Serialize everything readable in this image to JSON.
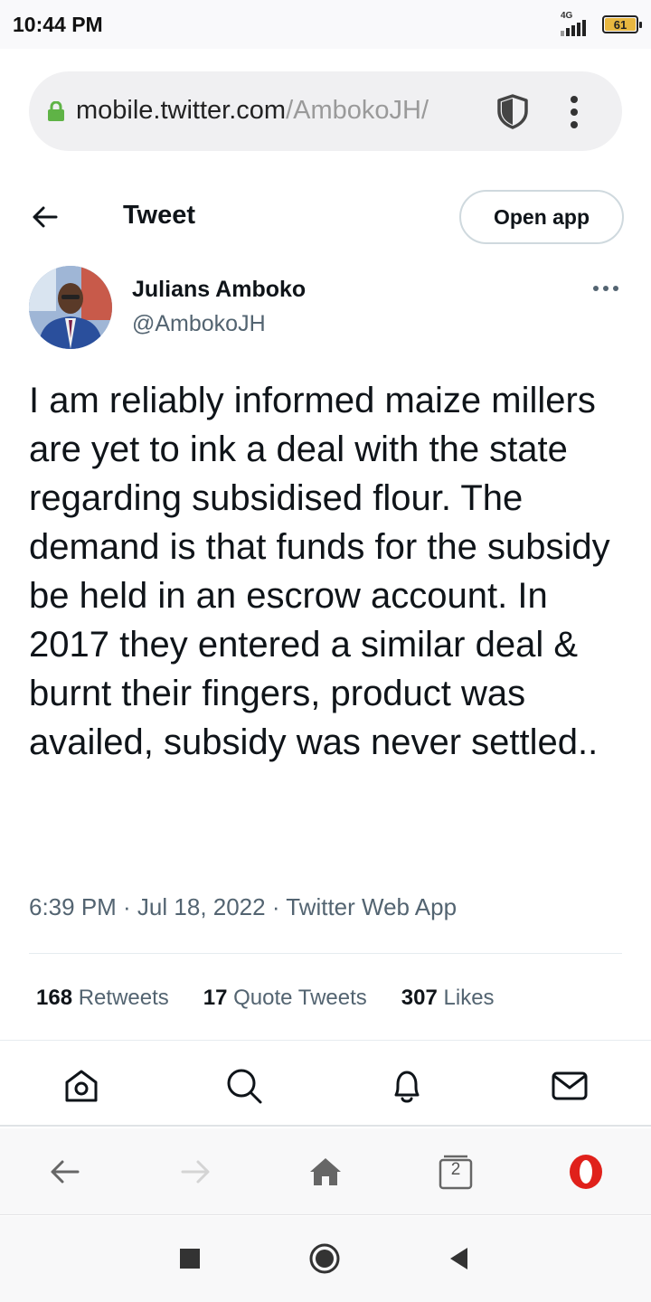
{
  "status_bar": {
    "time": "10:44 PM",
    "network": "4G",
    "battery": "61"
  },
  "browser": {
    "url_host": "mobile.twitter.com",
    "url_path": "/AmbokoJH/",
    "tab_count": "2"
  },
  "header": {
    "title": "Tweet",
    "open_app_label": "Open app"
  },
  "author": {
    "name": "Julians Amboko",
    "handle": "@AmbokoJH"
  },
  "tweet": {
    "text": "I am reliably informed maize millers are yet to ink a deal with the state regarding subsidised flour. The demand is that funds for the subsidy be held in an escrow account. In 2017 they entered a similar deal & burnt their fingers, product was availed, subsidy was never settled..",
    "meta": "6:39 PM · Jul 18, 2022 · Twitter Web App"
  },
  "stats": [
    {
      "count": "168",
      "label": "Retweets"
    },
    {
      "count": "17",
      "label": "Quote Tweets"
    },
    {
      "count": "307",
      "label": "Likes"
    }
  ],
  "colors": {
    "secure_lock": "#5fb346",
    "opera_red": "#e0211b",
    "battery": "#e8b740"
  },
  "icons": {
    "twitter_nav": [
      "home-icon",
      "search-icon",
      "bell-icon",
      "mail-icon"
    ],
    "browser_nav": [
      "back-arrow-icon",
      "forward-arrow-icon",
      "home-icon",
      "tabs-icon",
      "opera-icon"
    ],
    "system_nav": [
      "recents-icon",
      "home-circle-icon",
      "back-triangle-icon"
    ]
  }
}
